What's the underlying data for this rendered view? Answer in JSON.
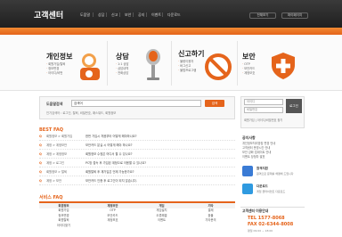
{
  "header": {
    "logo": "고객센터",
    "nav": [
      "도움말",
      "상담",
      "신고",
      "보안",
      "공지",
      "이벤트",
      "다운로드"
    ],
    "util": [
      "전체보기",
      "마이페이지"
    ]
  },
  "hero": {
    "categories": [
      {
        "title": "개인정보",
        "links": [
          "회원가입/탈퇴",
          "정보변경",
          "아이디/비번"
        ]
      },
      {
        "title": "상담",
        "links": [
          "1:1 상담",
          "상담내역",
          "전화상담"
        ]
      },
      {
        "title": "신고하기",
        "links": [
          "불량이용자",
          "버그신고",
          "불법프로그램"
        ]
      },
      {
        "title": "보안",
        "links": [
          "OTP",
          "보안카드",
          "계정보호"
        ]
      }
    ]
  },
  "search": {
    "label": "도움말검색",
    "value": "검색어",
    "button": "검색",
    "popular": "인기검색어 : 로그인, 탈퇴, 비밀번호, 패스워드, 회원정보"
  },
  "best_faq": {
    "title": "BEST FAQ",
    "items": [
      {
        "cat": "회원정보 > 회원가입",
        "q": "한번 가입시 처음부터 어떻게 해야하나요?"
      },
      {
        "cat": "계정 > 계정보안",
        "q": "보안카드 분실 시 어떻게 해야 하나요?"
      },
      {
        "cat": "계정 > 계정정보",
        "q": "회원정보 수정은 어디서 할 수 있나요?"
      },
      {
        "cat": "계정 > 로그인",
        "q": "PC방 접속 후 가입된 계정으로 이용할 수 있나요?"
      },
      {
        "cat": "회원정보 > 탈퇴",
        "q": "회원탈퇴 후 재가입은 언제 가능한가요?"
      },
      {
        "cat": "계정 > 보안",
        "q": "보안카드 인증 후 로그인이 되지 않습니다."
      }
    ]
  },
  "service_faq": {
    "title": "서비스 FAQ",
    "columns": [
      {
        "head": "회원정보",
        "items": [
          "회원가입",
          "정보변경",
          "회원탈퇴",
          "아이디찾기"
        ]
      },
      {
        "head": "계정보안",
        "items": [
          "OTP",
          "보안카드",
          "계정보호"
        ]
      },
      {
        "head": "게임",
        "items": [
          "게임설치",
          "오류해결",
          "이벤트"
        ]
      },
      {
        "head": "기타",
        "items": [
          "결제",
          "환불",
          "기타문의"
        ]
      }
    ]
  },
  "login": {
    "id_placeholder": "아이디",
    "pw_placeholder": "비밀번호",
    "button": "로그인",
    "links": "회원가입 | 아이디/비밀번호 찾기"
  },
  "notice": {
    "title": "공지사항",
    "items": [
      "개인정보처리방침 변경 안내",
      "고객센터 운영시간 안내",
      "보안 강화 업데이트 안내",
      "이벤트 당첨자 발표"
    ]
  },
  "quick": [
    {
      "label": "원격지원",
      "sub": "원격으로 문제를 해결해 드립니다",
      "color": "#3a7bd5"
    },
    {
      "label": "다운로드",
      "sub": "게임 클라이언트 다운로드",
      "color": "#2f9ae0"
    }
  ],
  "contact": {
    "head": "고객센터 이용안내",
    "tel": "TEL 1577-8068",
    "fax": "FAX 02-6344-8008",
    "hours": "평일 09:00 ~ 18:00"
  },
  "colors": {
    "accent": "#e5641b",
    "dark": "#222222"
  }
}
